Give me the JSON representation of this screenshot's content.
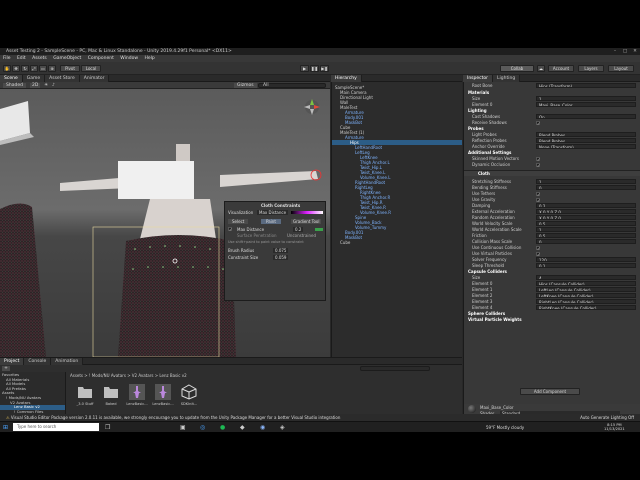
{
  "window": {
    "title": "Asset Testing 2 - SampleScene - PC, Mac & Linux Standalone - Unity 2019.4.29f1 Personal* <DX11>",
    "controls": [
      "–",
      "□",
      "✕"
    ]
  },
  "menu": [
    "File",
    "Edit",
    "Assets",
    "GameObject",
    "Component",
    "Window",
    "Help"
  ],
  "toolbar": {
    "pivot": "Pivot",
    "local": "Local",
    "collab": "Collab",
    "account": "Account",
    "layers": "Layers",
    "layout": "Layout"
  },
  "tabs": {
    "left": [
      "Scene",
      "Game",
      "Asset Store",
      "Animator"
    ],
    "hierarchy": "Hierarchy",
    "inspector": [
      "Inspector",
      "Lighting"
    ]
  },
  "scene_toolbar": {
    "shading": "Shaded",
    "mode": "2D",
    "gizmos": "Gizmos",
    "search": "All"
  },
  "hierarchy": {
    "items": [
      {
        "label": "SampleScene*",
        "indent": 0
      },
      {
        "label": "Main Camera",
        "indent": 1
      },
      {
        "label": "Directional Light",
        "indent": 1
      },
      {
        "label": "Wall",
        "indent": 1
      },
      {
        "label": "MaleTest",
        "indent": 1
      },
      {
        "label": "Armature",
        "indent": 2
      },
      {
        "label": "Body.001",
        "indent": 2
      },
      {
        "label": "MaskBot",
        "indent": 2
      },
      {
        "label": "Cube",
        "indent": 1
      },
      {
        "label": "MaleTest (1)",
        "indent": 1
      },
      {
        "label": "Armature",
        "indent": 2
      },
      {
        "label": "Hips",
        "indent": 3
      },
      {
        "label": "LeftHandRoot",
        "indent": 4
      },
      {
        "label": "LeftLeg",
        "indent": 4
      },
      {
        "label": "LeftKnee",
        "indent": 5
      },
      {
        "label": "Thigh Anchor.L",
        "indent": 5
      },
      {
        "label": "Twist_Hip.L",
        "indent": 5
      },
      {
        "label": "Twist_Knee.L",
        "indent": 5
      },
      {
        "label": "Volume_Knee.L",
        "indent": 5
      },
      {
        "label": "RightHandRoot",
        "indent": 4
      },
      {
        "label": "RightLeg",
        "indent": 4
      },
      {
        "label": "RightKnee",
        "indent": 5
      },
      {
        "label": "Thigh Anchor.R",
        "indent": 5
      },
      {
        "label": "Twist_Hip.R",
        "indent": 5
      },
      {
        "label": "Twist_Knee.R",
        "indent": 5
      },
      {
        "label": "Volume_Knee.R",
        "indent": 5
      },
      {
        "label": "Spine",
        "indent": 4
      },
      {
        "label": "Volume_Back",
        "indent": 4
      },
      {
        "label": "Volume_Tummy",
        "indent": 4
      },
      {
        "label": "Body.001",
        "indent": 2
      },
      {
        "label": "MaskBot",
        "indent": 2
      },
      {
        "label": "Cube",
        "indent": 1
      }
    ]
  },
  "cloth_constraints": {
    "title": "Cloth Constraints",
    "visualization_label": "Visualization",
    "visualization_value": "Max Distance",
    "select": "Select",
    "paint": "Paint",
    "gradient_tool": "Gradient Tool",
    "max_distance": "Max Distance",
    "max_distance_value": "0.2",
    "surface_penetration": "Surface Penetration",
    "unconstrained": "Unconstrained",
    "hint": "Use shift+paint to paint value to constraint",
    "brush_radius_label": "Brush Radius",
    "brush_radius": "0.075",
    "constraint_size_label": "Constraint Size",
    "constraint_size": "0.059"
  },
  "inspector": {
    "root_bone": "Root Bone",
    "root_bone_value": "Hips (Transform)",
    "rows": [
      {
        "label": "Materials",
        "value": "",
        "header": true
      },
      {
        "label": "Size",
        "value": "1"
      },
      {
        "label": "Element 0",
        "value": "Maxi_Base_Color"
      },
      {
        "label": "Lighting",
        "value": "",
        "header": true
      },
      {
        "label": "Cast Shadows",
        "value": "On"
      },
      {
        "label": "Receive Shadows",
        "value": "✓"
      },
      {
        "label": "Probes",
        "value": "",
        "header": true
      },
      {
        "label": "Light Probes",
        "value": "Blend Probes"
      },
      {
        "label": "Reflection Probes",
        "value": "Blend Probes"
      },
      {
        "label": "Anchor Override",
        "value": "None (Transform)"
      },
      {
        "label": "Additional Settings",
        "value": "",
        "header": true
      },
      {
        "label": "Skinned Motion Vectors",
        "value": "✓"
      },
      {
        "label": "Dynamic Occlusion",
        "value": "✓"
      }
    ],
    "cloth_header": "Cloth",
    "cloth_rows": [
      {
        "label": "Stretching Stiffness",
        "value": "1"
      },
      {
        "label": "Bending Stiffness",
        "value": "0"
      },
      {
        "label": "Use Tethers",
        "value": "✓"
      },
      {
        "label": "Use Gravity",
        "value": "✓"
      },
      {
        "label": "Damping",
        "value": "0.2"
      },
      {
        "label": "External Acceleration",
        "value": "X 0   Y 0   Z 0"
      },
      {
        "label": "Random Acceleration",
        "value": "X 0   Y 0   Z 0"
      },
      {
        "label": "World Velocity Scale",
        "value": "0.5"
      },
      {
        "label": "World Acceleration Scale",
        "value": "1"
      },
      {
        "label": "Friction",
        "value": "0.5"
      },
      {
        "label": "Collision Mass Scale",
        "value": "0"
      },
      {
        "label": "Use Continuous Collision",
        "value": "✓"
      },
      {
        "label": "Use Virtual Particles",
        "value": "✓"
      },
      {
        "label": "Solver Frequency",
        "value": "120"
      },
      {
        "label": "Sleep Threshold",
        "value": "0.1"
      },
      {
        "label": "Capsule Colliders",
        "value": "",
        "header": true
      },
      {
        "label": "Size",
        "value": "4"
      },
      {
        "label": "Element 0",
        "value": "Hips (Capsule Collider)"
      },
      {
        "label": "Element 1",
        "value": "LeftLeg (Capsule Collider)"
      },
      {
        "label": "Element 2",
        "value": "LeftKnee (Capsule Collider)"
      },
      {
        "label": "Element 3",
        "value": "RightLeg (Capsule Collider)"
      },
      {
        "label": "Element 4",
        "value": "RightKnee (Capsule Collider)"
      },
      {
        "label": "Sphere Colliders",
        "value": "",
        "header": true
      },
      {
        "label": "Virtual Particle Weights",
        "value": "",
        "header": true
      }
    ],
    "material_name": "Maxi_Base_Color",
    "shader_label": "Shader",
    "shader_value": "Standard",
    "add_component": "Add Component"
  },
  "project": {
    "tabs": [
      "Project",
      "Console",
      "Animation"
    ],
    "breadcrumb": "Assets > ! Mods/NU Avatars > V2 Avatars > Lenz Basic v2",
    "tree": [
      {
        "label": "Favorites",
        "indent": 0
      },
      {
        "label": "All Materials",
        "indent": 1
      },
      {
        "label": "All Models",
        "indent": 1
      },
      {
        "label": "All Prefabs",
        "indent": 1
      },
      {
        "label": "Assets",
        "indent": 0
      },
      {
        "label": "! Mods/NU Avatars",
        "indent": 1
      },
      {
        "label": "V2 Avatars",
        "indent": 2
      },
      {
        "label": "Lenz Basic v2",
        "indent": 3
      },
      {
        "label": "! Common Files",
        "indent": 3
      },
      {
        "label": "Hair",
        "indent": 3
      },
      {
        "label": "Shorts",
        "indent": 3
      },
      {
        "label": "Skirts",
        "indent": 3
      },
      {
        "label": "Thigh Highs",
        "indent": 3
      }
    ],
    "assets": [
      "_3.0 Stuff",
      "Baked",
      "LenzBasic...",
      "LenzBasic...",
      "SDKInit..."
    ]
  },
  "status": {
    "message": "Visual Studio Editor Package version 2.0.11 is available, we strongly encourage you to update from the Unity Package Manager for a better Visual Studio integration",
    "right": "Auto Generate Lighting Off"
  },
  "taskbar": {
    "search": "Type here to search",
    "weather": "59°F  Mostly cloudy",
    "time": "8:15 PM",
    "date": "11/13/2021"
  },
  "colors": {
    "selection": "#2c5d87",
    "skirt": "#3a2a2e",
    "accent_green": "#3aa14b"
  }
}
